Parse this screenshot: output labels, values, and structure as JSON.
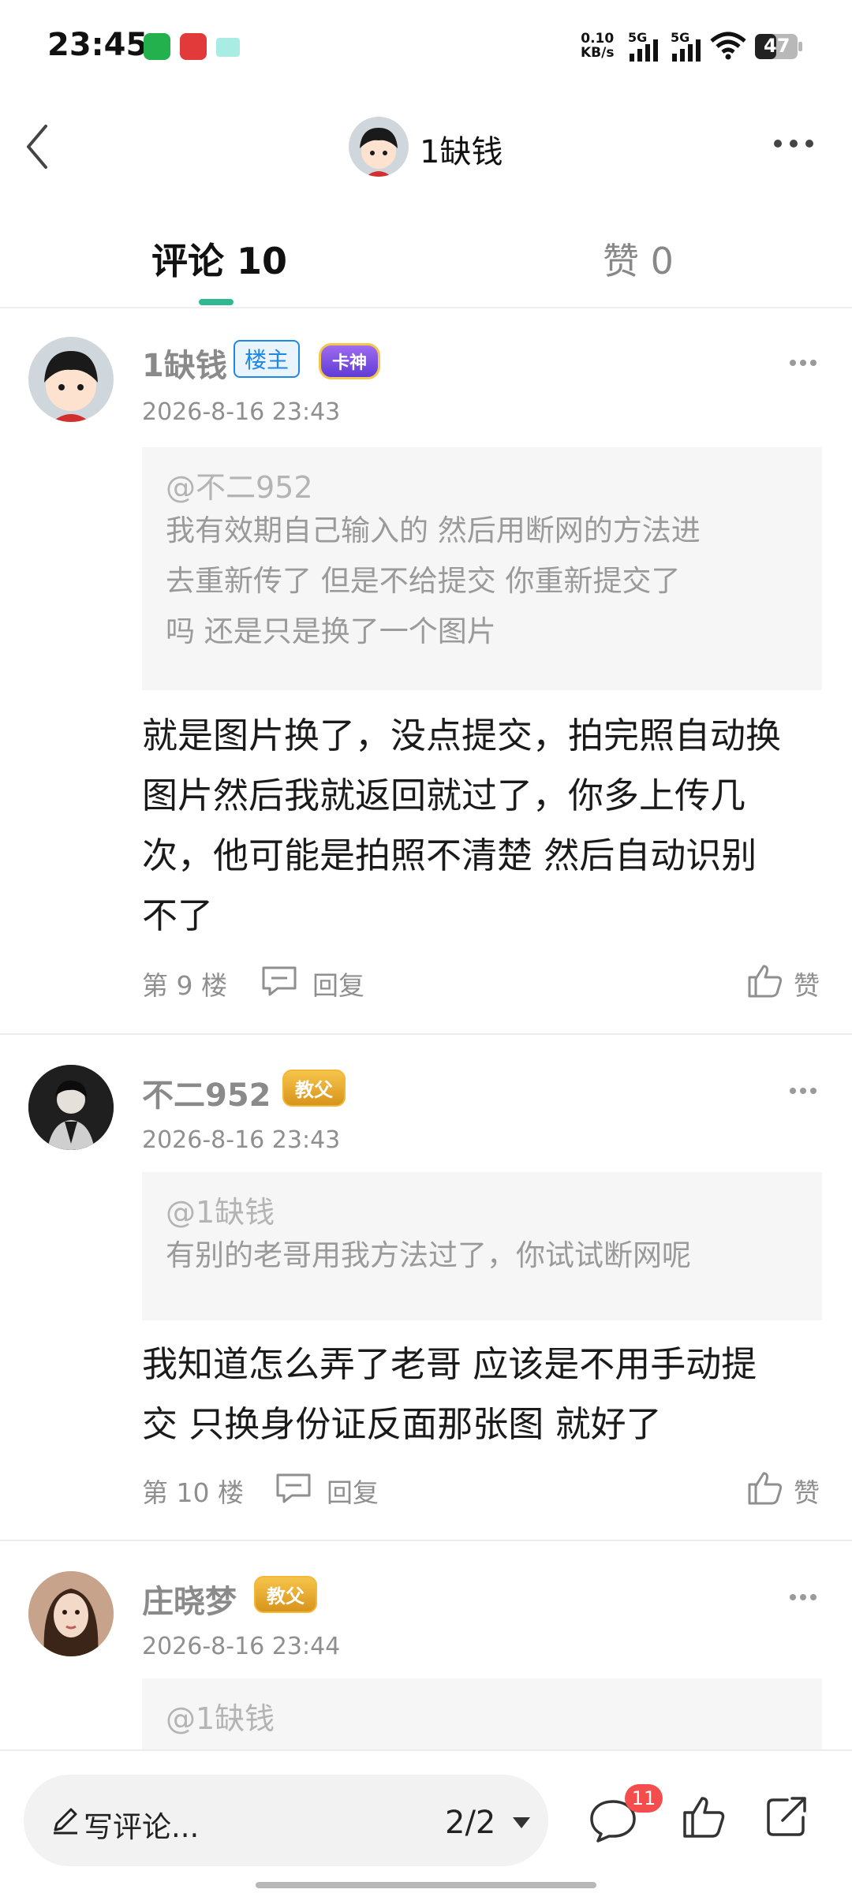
{
  "status_bar": {
    "time": "23:45",
    "net_speed_value": "0.10",
    "net_speed_unit": "KB/s",
    "signal1_label": "5G",
    "signal2_label": "5G",
    "battery": "47"
  },
  "header": {
    "title": "1缺钱",
    "back_icon": "chevron-left-icon",
    "more_icon": "more-horizontal-icon"
  },
  "tabs": {
    "comments": "评论 10",
    "likes": "赞 0"
  },
  "comments": [
    {
      "username": "1缺钱",
      "op_badge": "楼主",
      "special_badge": "卡神",
      "time": "2026-8-16 23:43",
      "quote_at": "@不二952",
      "quote_lines": [
        "我有效期自己输入的  然后用断网的方法进",
        "去重新传了 但是不给提交 你重新提交了",
        "吗  还是只是换了一个图片"
      ],
      "body_lines": [
        "就是图片换了，没点提交，拍完照自动换",
        "图片然后我就返回就过了，你多上传几",
        "次，他可能是拍照不清楚 然后自动识别",
        "不了"
      ],
      "floor": "第 9 楼",
      "reply": "回复",
      "like": "赞"
    },
    {
      "username": "不二952",
      "special_badge": "教父",
      "time": "2026-8-16 23:43",
      "quote_at": "@1缺钱",
      "quote_lines": [
        "有别的老哥用我方法过了，你试试断网呢"
      ],
      "body_lines": [
        "我知道怎么弄了老哥 应该是不用手动提",
        "交 只换身份证反面那张图 就好了"
      ],
      "floor": "第 10 楼",
      "reply": "回复",
      "like": "赞"
    },
    {
      "username": "庄晓梦",
      "special_badge": "教父",
      "time": "2026-8-16 23:44",
      "quote_at": "@1缺钱"
    }
  ],
  "bottom_bar": {
    "placeholder": "写评论...",
    "page": "2/2",
    "unread_count": "11"
  },
  "colors": {
    "accent": "#2fb892",
    "badge_red": "#f44d4d",
    "op_blue": "#1e88e5"
  }
}
